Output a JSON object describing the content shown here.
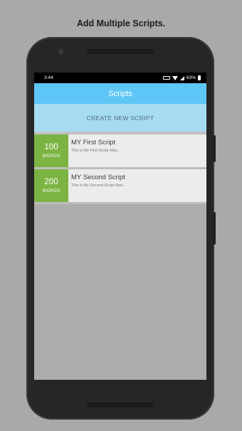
{
  "promo": {
    "headline": "Add Multiple Scripts."
  },
  "status_bar": {
    "time": "3:44",
    "battery": "63%"
  },
  "app": {
    "title": "Scripts",
    "create_label": "CREATE NEW SCRIPT",
    "scripts": [
      {
        "count": "100",
        "unit": "WORDS",
        "title": "MY First Script",
        "description": "This is My First Script Man."
      },
      {
        "count": "200",
        "unit": "WORDS",
        "title": "MY Second Script",
        "description": "This is My Second Script Man."
      }
    ]
  },
  "colors": {
    "toolbar": "#5ec6f6",
    "create_button": "#a6dcf2",
    "word_badge": "#7cb444",
    "background": "#a9a9a9"
  },
  "icons": [
    "battery-saver-icon",
    "wifi-icon",
    "signal-icon",
    "battery-icon",
    "camera-icon",
    "speaker-icon"
  ]
}
